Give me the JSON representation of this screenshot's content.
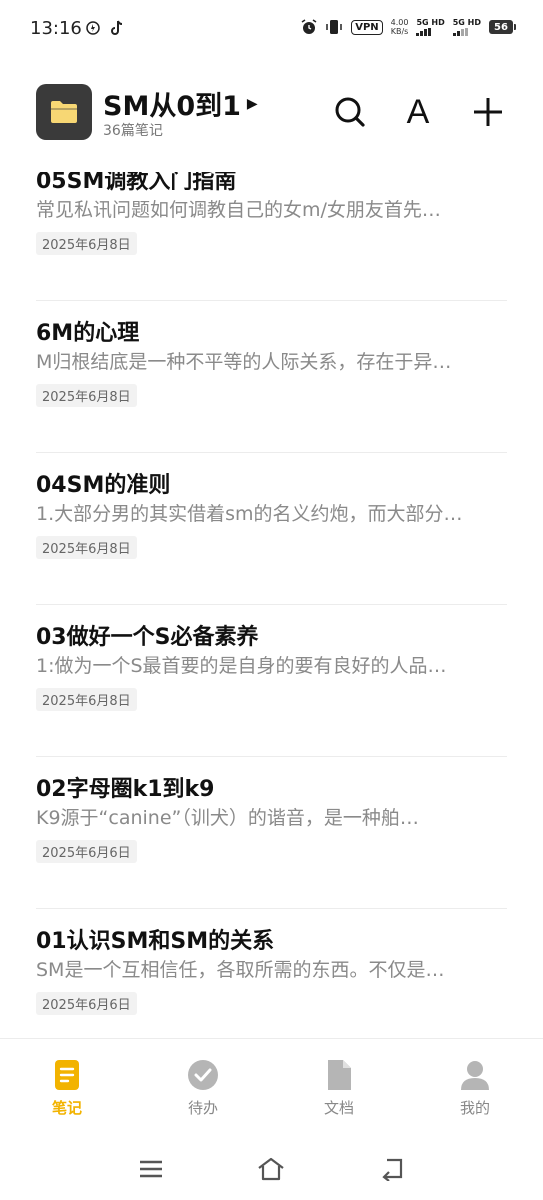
{
  "status": {
    "time": "13:16",
    "vpn": "VPN",
    "speed_value": "4.00",
    "speed_unit": "KB/s",
    "sim1": "5G HD",
    "sim2": "5G HD",
    "battery": "56"
  },
  "header": {
    "title": "SM从0到1",
    "count": "36篇笔记",
    "font_button": "A"
  },
  "notes": [
    {
      "title": "05SM调教入门指南",
      "preview": "常见私讯问题如何调教自己的女m/女朋友首先…",
      "date": "2025年6月8日"
    },
    {
      "title": "6M的心理",
      "preview": "M归根结底是一种不平等的人际关系，存在于异…",
      "date": "2025年6月8日"
    },
    {
      "title": "04SM的准则",
      "preview": "1.大部分男的其实借着sm的名义约炮，而大部分…",
      "date": "2025年6月8日"
    },
    {
      "title": "03做好一个S必备素养",
      "preview": "1:做为一个S最首要的是自身的要有良好的人品…",
      "date": "2025年6月8日"
    },
    {
      "title": "02字母圈k1到k9",
      "preview": "K9源于“canine”（训犬）的谐音，是一种舶…",
      "date": "2025年6月6日"
    },
    {
      "title": "01认识SM和SM的关系",
      "preview": "SM是一个互相信任，各取所需的东西。不仅是…",
      "date": "2025年6月6日"
    }
  ],
  "bottom_nav": [
    {
      "label": "笔记",
      "icon": "note-icon",
      "active": true
    },
    {
      "label": "待办",
      "icon": "check-circle-icon",
      "active": false
    },
    {
      "label": "文档",
      "icon": "document-icon",
      "active": false
    },
    {
      "label": "我的",
      "icon": "person-icon",
      "active": false
    }
  ],
  "colors": {
    "accent": "#f2b300",
    "folder_bg": "#3a3a3a",
    "folder_icon": "#f7d774"
  }
}
